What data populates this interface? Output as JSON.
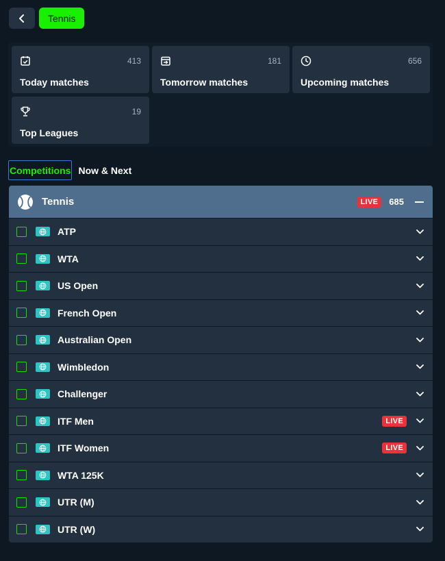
{
  "header": {
    "back_icon": "chevron-left-icon",
    "sport_chip": "Tennis"
  },
  "cards": [
    {
      "label": "Today matches",
      "count": "413",
      "icon": "calendar-check-icon"
    },
    {
      "label": "Tomorrow matches",
      "count": "181",
      "icon": "calendar-arrow-icon"
    },
    {
      "label": "Upcoming matches",
      "count": "656",
      "icon": "clock-icon"
    },
    {
      "label": "Top Leagues",
      "count": "19",
      "icon": "trophy-icon"
    }
  ],
  "tabs": {
    "competitions": "Competitions",
    "now_next": "Now & Next"
  },
  "sport": {
    "name": "Tennis",
    "live": "LIVE",
    "count": "685",
    "icon": "tennis-ball-icon"
  },
  "competitions": [
    {
      "name": "ATP",
      "live": ""
    },
    {
      "name": "WTA",
      "live": ""
    },
    {
      "name": "US Open",
      "live": ""
    },
    {
      "name": "French Open",
      "live": ""
    },
    {
      "name": "Australian Open",
      "live": ""
    },
    {
      "name": "Wimbledon",
      "live": ""
    },
    {
      "name": "Challenger",
      "live": ""
    },
    {
      "name": "ITF Men",
      "live": "LIVE"
    },
    {
      "name": "ITF Women",
      "live": "LIVE"
    },
    {
      "name": "WTA 125K",
      "live": ""
    },
    {
      "name": "UTR (M)",
      "live": ""
    },
    {
      "name": "UTR (W)",
      "live": ""
    }
  ],
  "colors": {
    "accent": "#19f000",
    "background": "#0e1822",
    "card": "#223040",
    "sport_header": "#4f6d8c",
    "live": "#e8333a",
    "globe": "#2ec4c4"
  }
}
